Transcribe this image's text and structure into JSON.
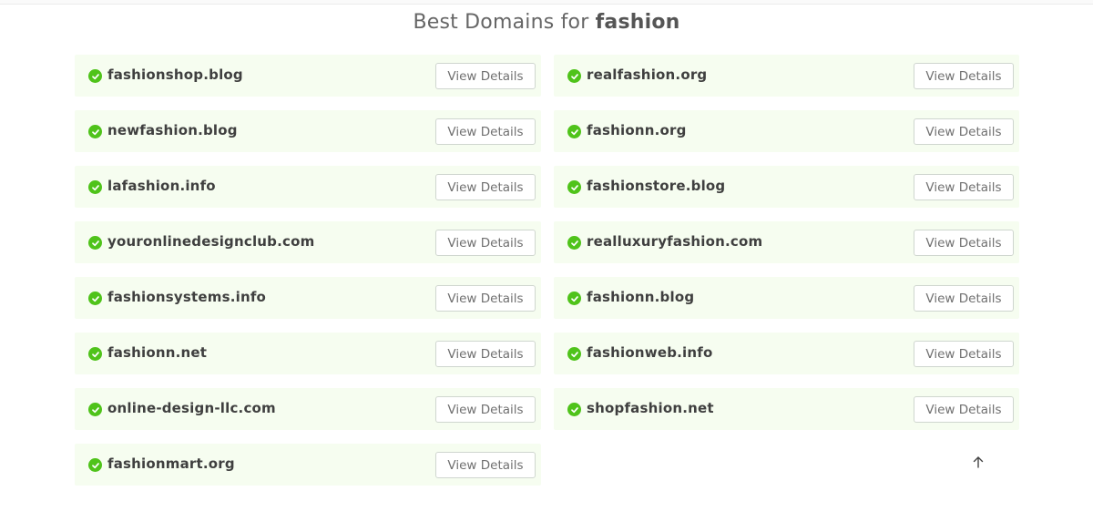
{
  "header": {
    "title_prefix": "Best Domains for",
    "keyword": "fashion"
  },
  "domains_left": [
    {
      "name": "fashionshop.blog",
      "button": "View Details"
    },
    {
      "name": "newfashion.blog",
      "button": "View Details"
    },
    {
      "name": "lafashion.info",
      "button": "View Details"
    },
    {
      "name": "youronlinedesignclub.com",
      "button": "View Details"
    },
    {
      "name": "fashionsystems.info",
      "button": "View Details"
    },
    {
      "name": "fashionn.net",
      "button": "View Details"
    },
    {
      "name": "online-design-llc.com",
      "button": "View Details"
    },
    {
      "name": "fashionmart.org",
      "button": "View Details"
    }
  ],
  "domains_right": [
    {
      "name": "realfashion.org",
      "button": "View Details"
    },
    {
      "name": "fashionn.org",
      "button": "View Details"
    },
    {
      "name": "fashionstore.blog",
      "button": "View Details"
    },
    {
      "name": "realluxuryfashion.com",
      "button": "View Details"
    },
    {
      "name": "fashionn.blog",
      "button": "View Details"
    },
    {
      "name": "fashionweb.info",
      "button": "View Details"
    },
    {
      "name": "shopfashion.net",
      "button": "View Details"
    }
  ],
  "icons": {
    "available": "check-circle-icon",
    "scroll_top": "arrow-up-icon"
  },
  "colors": {
    "card_bg": "#f6fdf0",
    "check_green": "#4fc31a",
    "button_border": "#cfd6cf"
  }
}
